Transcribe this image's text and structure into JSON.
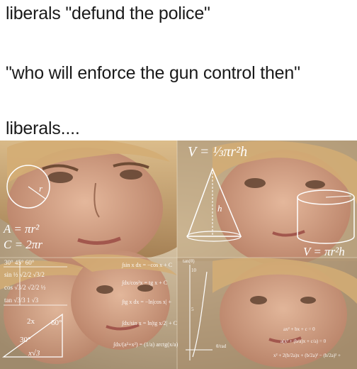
{
  "captions": {
    "line1": "liberals \"defund the police\"",
    "line2": "\"who will enforce the gun control then\"",
    "line3": "liberals...."
  },
  "image": {
    "math": {
      "volume_cone": "V = ⅓πr²h",
      "area_circle": "A = πr²",
      "circumference": "C = 2πr",
      "volume_cylinder": "V = πr²h",
      "radius_label": "r",
      "height_label": "h",
      "trig_header": "30°  45°  60°",
      "sin_row": "sin  ½  √2/2  √3/2",
      "cos_row": "cos  √3/2  √2/2  ½",
      "tan_row": "tan  √3/3  1  √3",
      "angle_60": "60°",
      "angle_30": "30°",
      "side_2x": "2x",
      "side_x_root3": "x√3",
      "integral_sin": "∫sin x dx = −cos x + C",
      "integral_sec": "∫dx/cos²x = tg x + C",
      "integral_tg": "∫tg x dx = −ln|cos x| +",
      "integral_csc": "∫dx/sin x = ln|tg x/2| + C",
      "integral_arctg": "∫dx/(a²+x²) = (1/a) arctg(x/a)",
      "tan_graph": "tan(θ)",
      "tick_10": "10",
      "tick_5": "5",
      "quadratic": "ax² + bx + c = 0",
      "quad_a": "a(x² + (b/a)x + c/a) = 0",
      "quad_b": "x² + 2(b/2a)x + (b/2a)² − (b/2a)² +",
      "unit_rad": "θ/rad"
    },
    "colors": {
      "background": "#c7b497",
      "hair": "#d8b37a",
      "skin": "#dba98c",
      "overlay": "#ffffff"
    }
  }
}
